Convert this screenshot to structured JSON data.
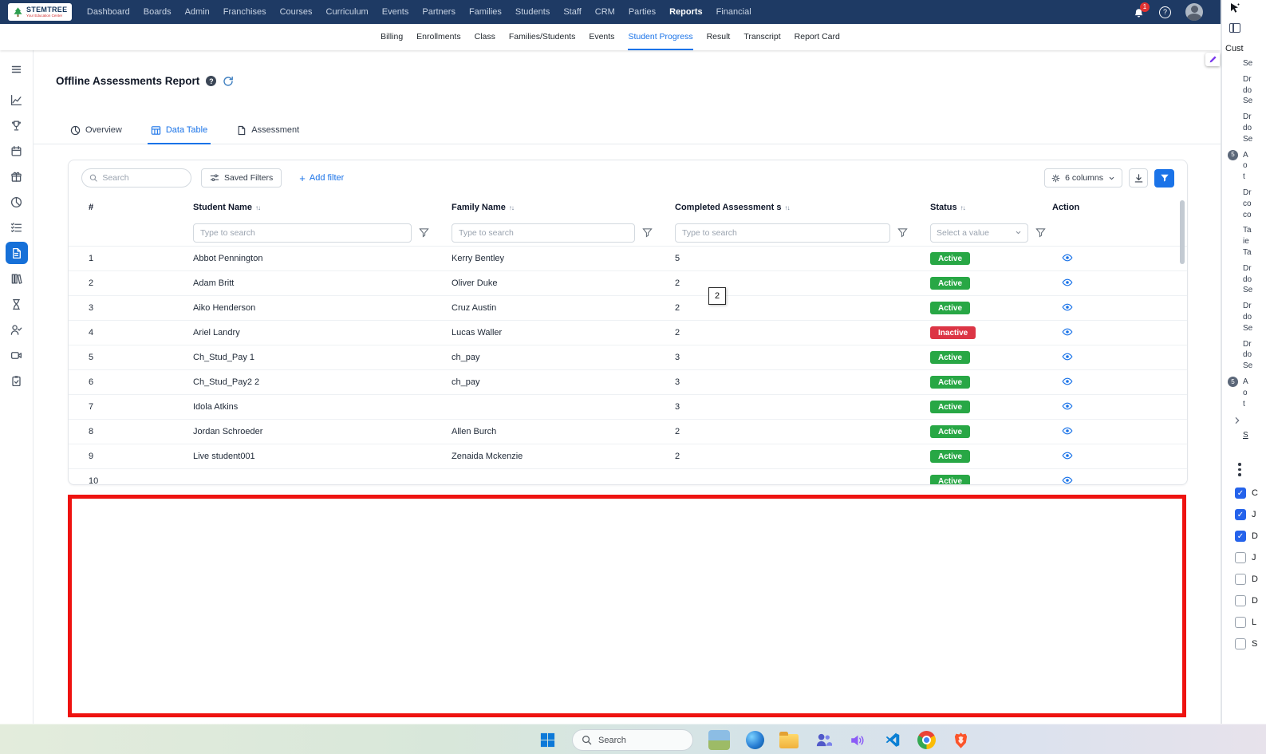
{
  "colors": {
    "topnav_bg": "#1e3a64",
    "accent_blue": "#1a73e8",
    "active_green": "#28a745",
    "inactive_red": "#dc3545",
    "annotation_red": "#ee1310",
    "sidebar_active": "#1670d8"
  },
  "topnav": {
    "logo_text": "STEMTREE",
    "logo_tagline": "Your Education Center",
    "items": [
      "Dashboard",
      "Boards",
      "Admin",
      "Franchises",
      "Courses",
      "Curriculum",
      "Events",
      "Partners",
      "Families",
      "Students",
      "Staff",
      "CRM",
      "Parties",
      "Reports",
      "Financial"
    ],
    "active_item": "Reports",
    "notification_badge": "1",
    "help_glyph": "?"
  },
  "subnav": {
    "items": [
      "Billing",
      "Enrollments",
      "Class",
      "Families/Students",
      "Events",
      "Student Progress",
      "Result",
      "Transcript",
      "Report Card"
    ],
    "active_item": "Student Progress"
  },
  "sidebar": {
    "items": [
      "menu",
      "line-chart",
      "trophy",
      "calendar",
      "gift",
      "pie-chart",
      "checklist",
      "assessments",
      "library",
      "hourglass",
      "user-check",
      "video",
      "clipboard"
    ],
    "active_item": "assessments"
  },
  "page": {
    "title": "Offline Assessments Report",
    "tabs": [
      {
        "label": "Overview"
      },
      {
        "label": "Data Table"
      },
      {
        "label": "Assessment"
      }
    ],
    "active_tab": "Data Table"
  },
  "toolbar": {
    "search_placeholder": "Search",
    "saved_filters_label": "Saved Filters",
    "add_filter_label": "Add filter",
    "columns_button_label": "6 columns"
  },
  "table": {
    "headers": [
      "#",
      "Student Name",
      "Family Name",
      "Completed Assessment s",
      "Status",
      "Action"
    ],
    "filter_placeholder": "Type to search",
    "status_filter_placeholder": "Select a value",
    "rows": [
      {
        "num": "1",
        "student": "Abbot Pennington",
        "family": "Kerry Bentley",
        "completed": "5",
        "status": "Active"
      },
      {
        "num": "2",
        "student": "Adam Britt",
        "family": "Oliver Duke",
        "completed": "2",
        "status": "Active"
      },
      {
        "num": "3",
        "student": "Aiko Henderson",
        "family": "Cruz Austin",
        "completed": "2",
        "status": "Active"
      },
      {
        "num": "4",
        "student": "Ariel Landry",
        "family": "Lucas Waller",
        "completed": "2",
        "status": "Inactive"
      },
      {
        "num": "5",
        "student": "Ch_Stud_Pay 1",
        "family": "ch_pay",
        "completed": "3",
        "status": "Active"
      },
      {
        "num": "6",
        "student": "Ch_Stud_Pay2 2",
        "family": "ch_pay",
        "completed": "3",
        "status": "Active"
      },
      {
        "num": "7",
        "student": "Idola Atkins",
        "family": "",
        "completed": "3",
        "status": "Active"
      },
      {
        "num": "8",
        "student": "Jordan Schroeder",
        "family": "Allen Burch",
        "completed": "2",
        "status": "Active"
      },
      {
        "num": "9",
        "student": "Live student001",
        "family": "Zenaida Mckenzie",
        "completed": "2",
        "status": "Active"
      }
    ],
    "partial_row": {
      "num": "10",
      "student": "",
      "family": "",
      "completed": "",
      "status": "Active"
    }
  },
  "annotations": {
    "floating_value": "2"
  },
  "right_panel": {
    "header": "Cust",
    "groups": [
      {
        "badge": "",
        "lines": [
          "Se"
        ]
      },
      {
        "badge": "",
        "lines": [
          "Dr",
          "do",
          "Se"
        ]
      },
      {
        "badge": "",
        "lines": [
          "Dr",
          "do",
          "Se"
        ]
      },
      {
        "badge": "5",
        "lines": [
          "A",
          "o",
          "t"
        ]
      },
      {
        "badge": "",
        "lines": [
          "Dr",
          "co",
          "co"
        ]
      },
      {
        "badge": "",
        "lines": [
          "Ta",
          "ie",
          "Ta"
        ]
      },
      {
        "badge": "",
        "lines": [
          "Dr",
          "do",
          "Se"
        ]
      },
      {
        "badge": "",
        "lines": [
          "Dr",
          "do",
          "Se"
        ]
      },
      {
        "badge": "",
        "lines": [
          "Dr",
          "do",
          "Se"
        ]
      },
      {
        "badge": "5",
        "lines": [
          "A",
          "o",
          "t"
        ]
      }
    ],
    "link_text": "S",
    "checkboxes": [
      {
        "label": "C",
        "checked": true
      },
      {
        "label": "J",
        "checked": true
      },
      {
        "label": "D",
        "checked": true
      },
      {
        "label": "J",
        "checked": false
      },
      {
        "label": "D",
        "checked": false
      },
      {
        "label": "D",
        "checked": false
      },
      {
        "label": "L",
        "checked": false
      },
      {
        "label": "S",
        "checked": false
      }
    ]
  },
  "taskbar": {
    "search_label": "Search"
  }
}
